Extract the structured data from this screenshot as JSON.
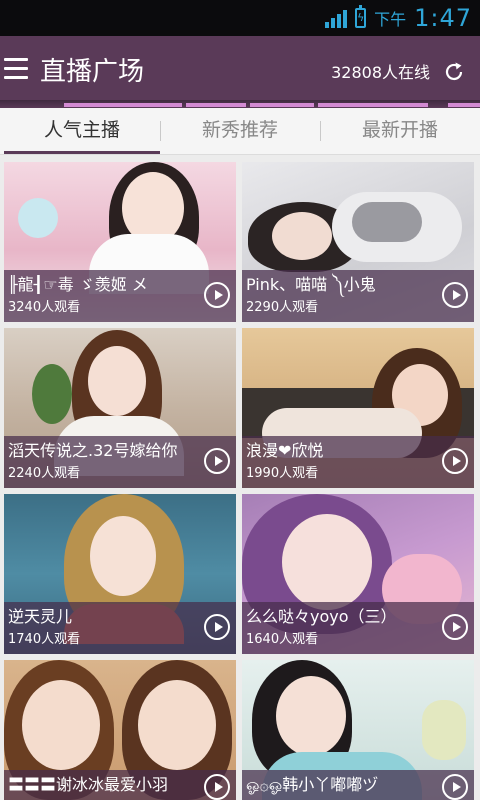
{
  "status_bar": {
    "period": "下午",
    "time": "1:47"
  },
  "header": {
    "title": "直播广场",
    "online_count": "32808人在线"
  },
  "tabs": [
    {
      "label": "人气主播",
      "active": true
    },
    {
      "label": "新秀推荐",
      "active": false
    },
    {
      "label": "最新开播",
      "active": false
    }
  ],
  "streams": [
    {
      "name": "╟龍┨☞毒 ゞ羡姬 メ",
      "viewers": "3240人观看"
    },
    {
      "name": "Pink、喵喵 ༽小鬼",
      "viewers": "2290人观看"
    },
    {
      "name": "滔天传说之.32号嫁给你",
      "viewers": "2240人观看"
    },
    {
      "name": "浪漫❤欣悦",
      "viewers": "1990人观看"
    },
    {
      "name": "逆天灵儿",
      "viewers": "1740人观看"
    },
    {
      "name": "么么哒々yoyo（三）",
      "viewers": "1640人观看"
    },
    {
      "name": "〓〓〓谢冰冰最爱小羽",
      "viewers": ""
    },
    {
      "name": "ஓ۞ஓ韩小丫嘟嘟ヅ",
      "viewers": ""
    }
  ],
  "colors": {
    "header": "#5a3a58",
    "status_accent": "#2fa6d8",
    "card_overlay": "rgba(70,45,75,0.72)"
  },
  "icons": {
    "menu": "hamburger-icon",
    "refresh": "refresh-icon",
    "play": "play-icon",
    "signal": "signal-icon",
    "battery": "battery-icon"
  }
}
